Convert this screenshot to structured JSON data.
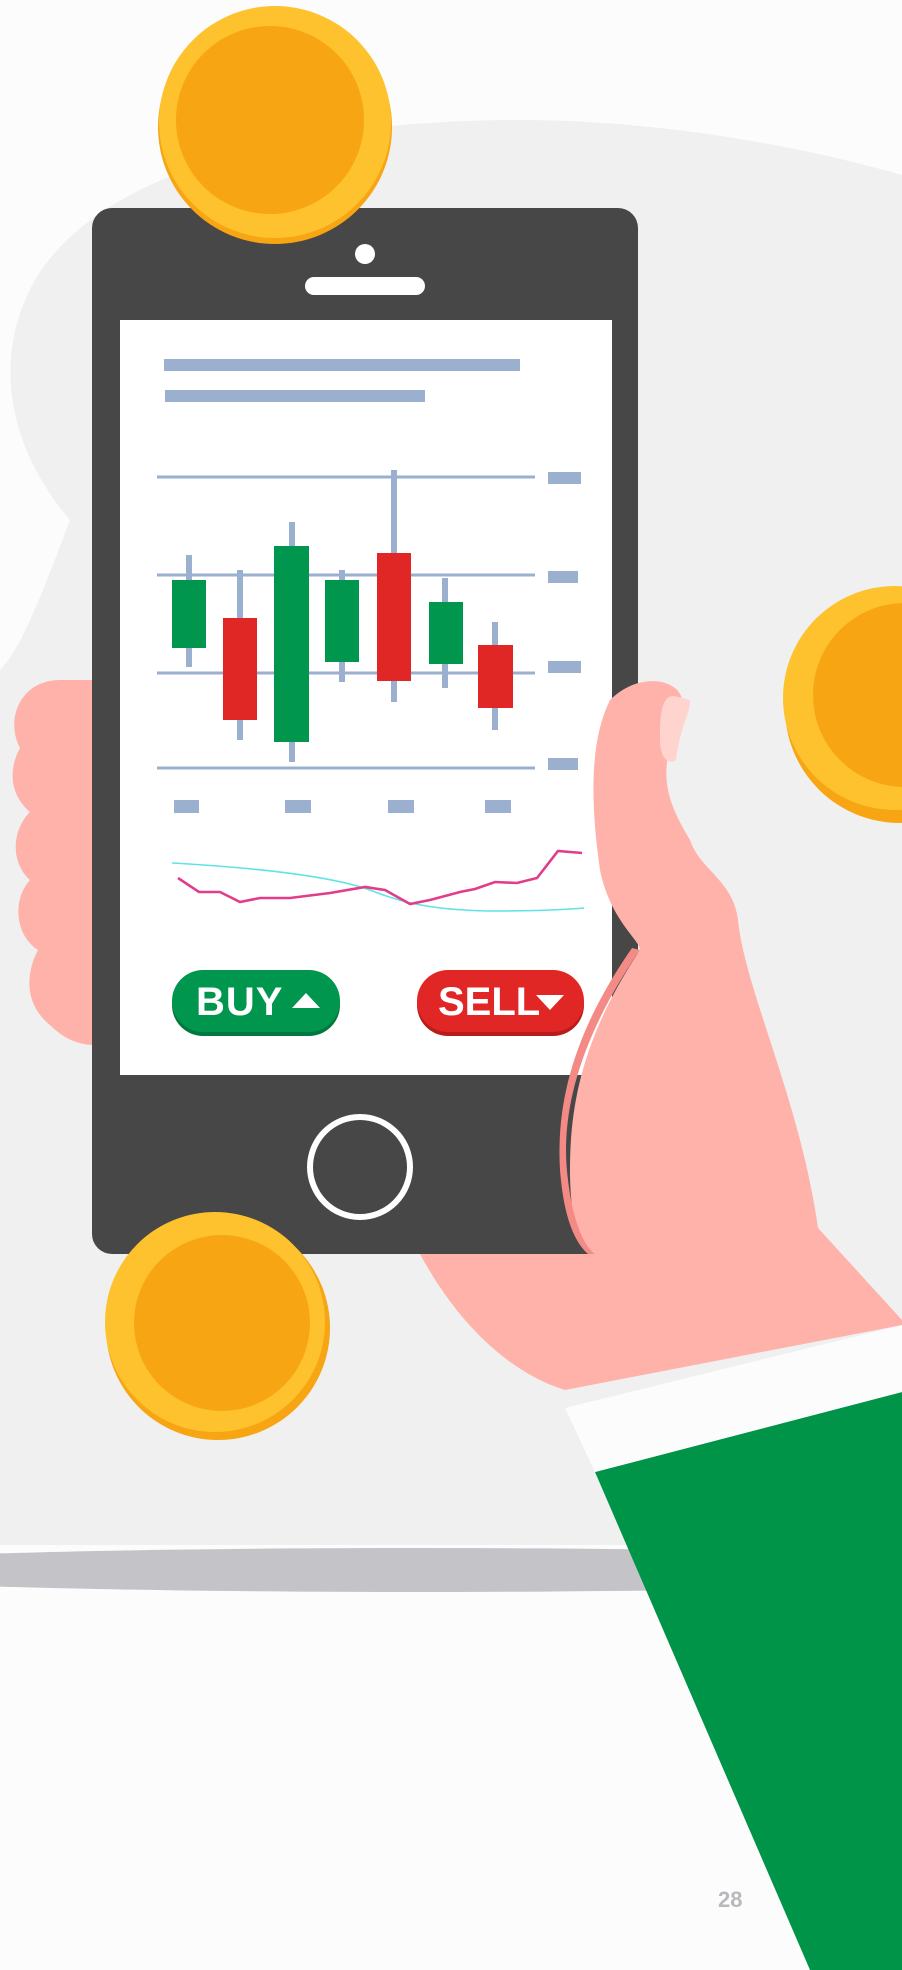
{
  "trading_screen": {
    "buy_label": "BUY",
    "sell_label": "SELL",
    "buy_icon": "triangle-up-icon",
    "sell_icon": "triangle-down-icon"
  },
  "page": {
    "number": "28"
  },
  "colors": {
    "background": "#fcfcfc",
    "backdrop_blob": "#f0f0f0",
    "floor_shadow": "#c4c3c8",
    "phone_body": "#474747",
    "screen": "#ffffff",
    "placeholder_blue": "#9bb0cf",
    "bull_green": "#00964e",
    "bear_red": "#e12726",
    "coin_outer": "#f7a512",
    "coin_rim": "#fdc22d",
    "skin": "#ffb2a9",
    "skin_shadow": "#f48a86",
    "sleeve": "#009448",
    "indicator_pink": "#e23c8a",
    "indicator_cyan": "#5fe3e6"
  }
}
